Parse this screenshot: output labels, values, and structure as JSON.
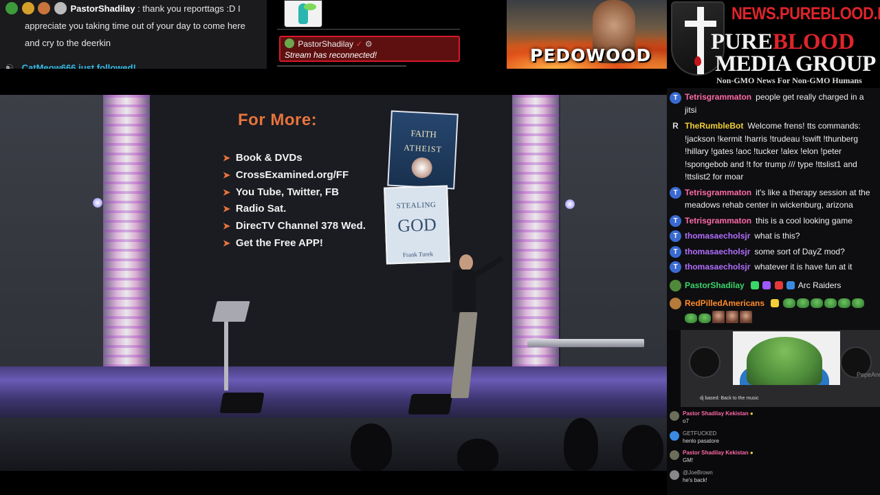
{
  "top_chat": {
    "line1_user": "PastorShadilay",
    "line1_msg": ": thank you reporttags :D I",
    "line2": "appreciate you taking time out of your day to come here",
    "line3": "and cry to the deerkin",
    "follow": "CatMeow666 just followed!"
  },
  "reconnect": {
    "user": "PastorShadilay",
    "message": "Stream has reconnected!"
  },
  "banner": {
    "text": "PEDOWOOD"
  },
  "logo": {
    "site": "NEWS.PUREBLOOD.MEDIA",
    "line1_a": "P",
    "line1_b": "URE",
    "line1_c": "BLOOD",
    "line2": "MEDIA GROUP",
    "tagline": "Non-GMO News For Non-GMO Humans"
  },
  "slide": {
    "title": "For More:",
    "items": [
      "Book & DVDs",
      "CrossExamined.org/FF",
      "You Tube, Twitter, FB",
      "Radio Sat.",
      "DirecTV Channel 378 Wed.",
      "Get the Free APP!"
    ],
    "book1_title": "FAITH",
    "book1_subtitle": "ATHEIST",
    "book2_title": "STEALING",
    "book2_god": "GOD",
    "book2_author": "Frank Turek"
  },
  "right_chat": [
    {
      "user": "Tetrisgrammaton",
      "msg": "people get really charged in a jitsi",
      "avatar": "T",
      "color": "pink"
    },
    {
      "user": "TheRumbleBot",
      "msg": "Welcome frens! tts commands: !jackson !kermit !harris !trudeau !swift !thunberg !hillary !gates !aoc !tucker !alex !elon !peter !spongebob and !t for trump /// type !ttslist1 and !ttslist2 for moar",
      "avatar": "R",
      "color": "yellow"
    },
    {
      "user": "Tetrisgrammaton",
      "msg": "it's like a therapy session at the meadows rehab center in wickenburg, arizona",
      "avatar": "T",
      "color": "pink"
    },
    {
      "user": "Tetrisgrammaton",
      "msg": "this is a cool looking game",
      "avatar": "T",
      "color": "pink"
    },
    {
      "user": "thomasaecholsjr",
      "msg": "what is this?",
      "avatar": "T",
      "color": "purple"
    },
    {
      "user": "thomasaecholsjr",
      "msg": "some sort of DayZ mod?",
      "avatar": "T",
      "color": "purple"
    },
    {
      "user": "thomasaecholsjr",
      "msg": "whatever it is have fun at it",
      "avatar": "T",
      "color": "purple"
    },
    {
      "user": "PastorShadilay",
      "msg": "Arc Raiders",
      "avatar": "",
      "color": "green"
    },
    {
      "user": "RedPilledAmericans",
      "msg": "",
      "avatar": "",
      "color": "orange"
    }
  ],
  "mini_stream": {
    "caption": "PepeAndFre",
    "subtitle": "dj based: Back to the music"
  },
  "small_chat": [
    {
      "user": "Pastor Shadilay Kekistan",
      "msg": "o7"
    },
    {
      "user": "GETFUCKED",
      "msg": "henlo pasatore"
    },
    {
      "user": "Pastor Shadilay Kekistan",
      "msg": "GM!"
    },
    {
      "user": "@JoeBrown",
      "msg": "he's back!"
    }
  ],
  "colors": {
    "accent_red": "#d8192b",
    "slide_orange": "#e8743b",
    "chat_link": "#33bce8"
  }
}
